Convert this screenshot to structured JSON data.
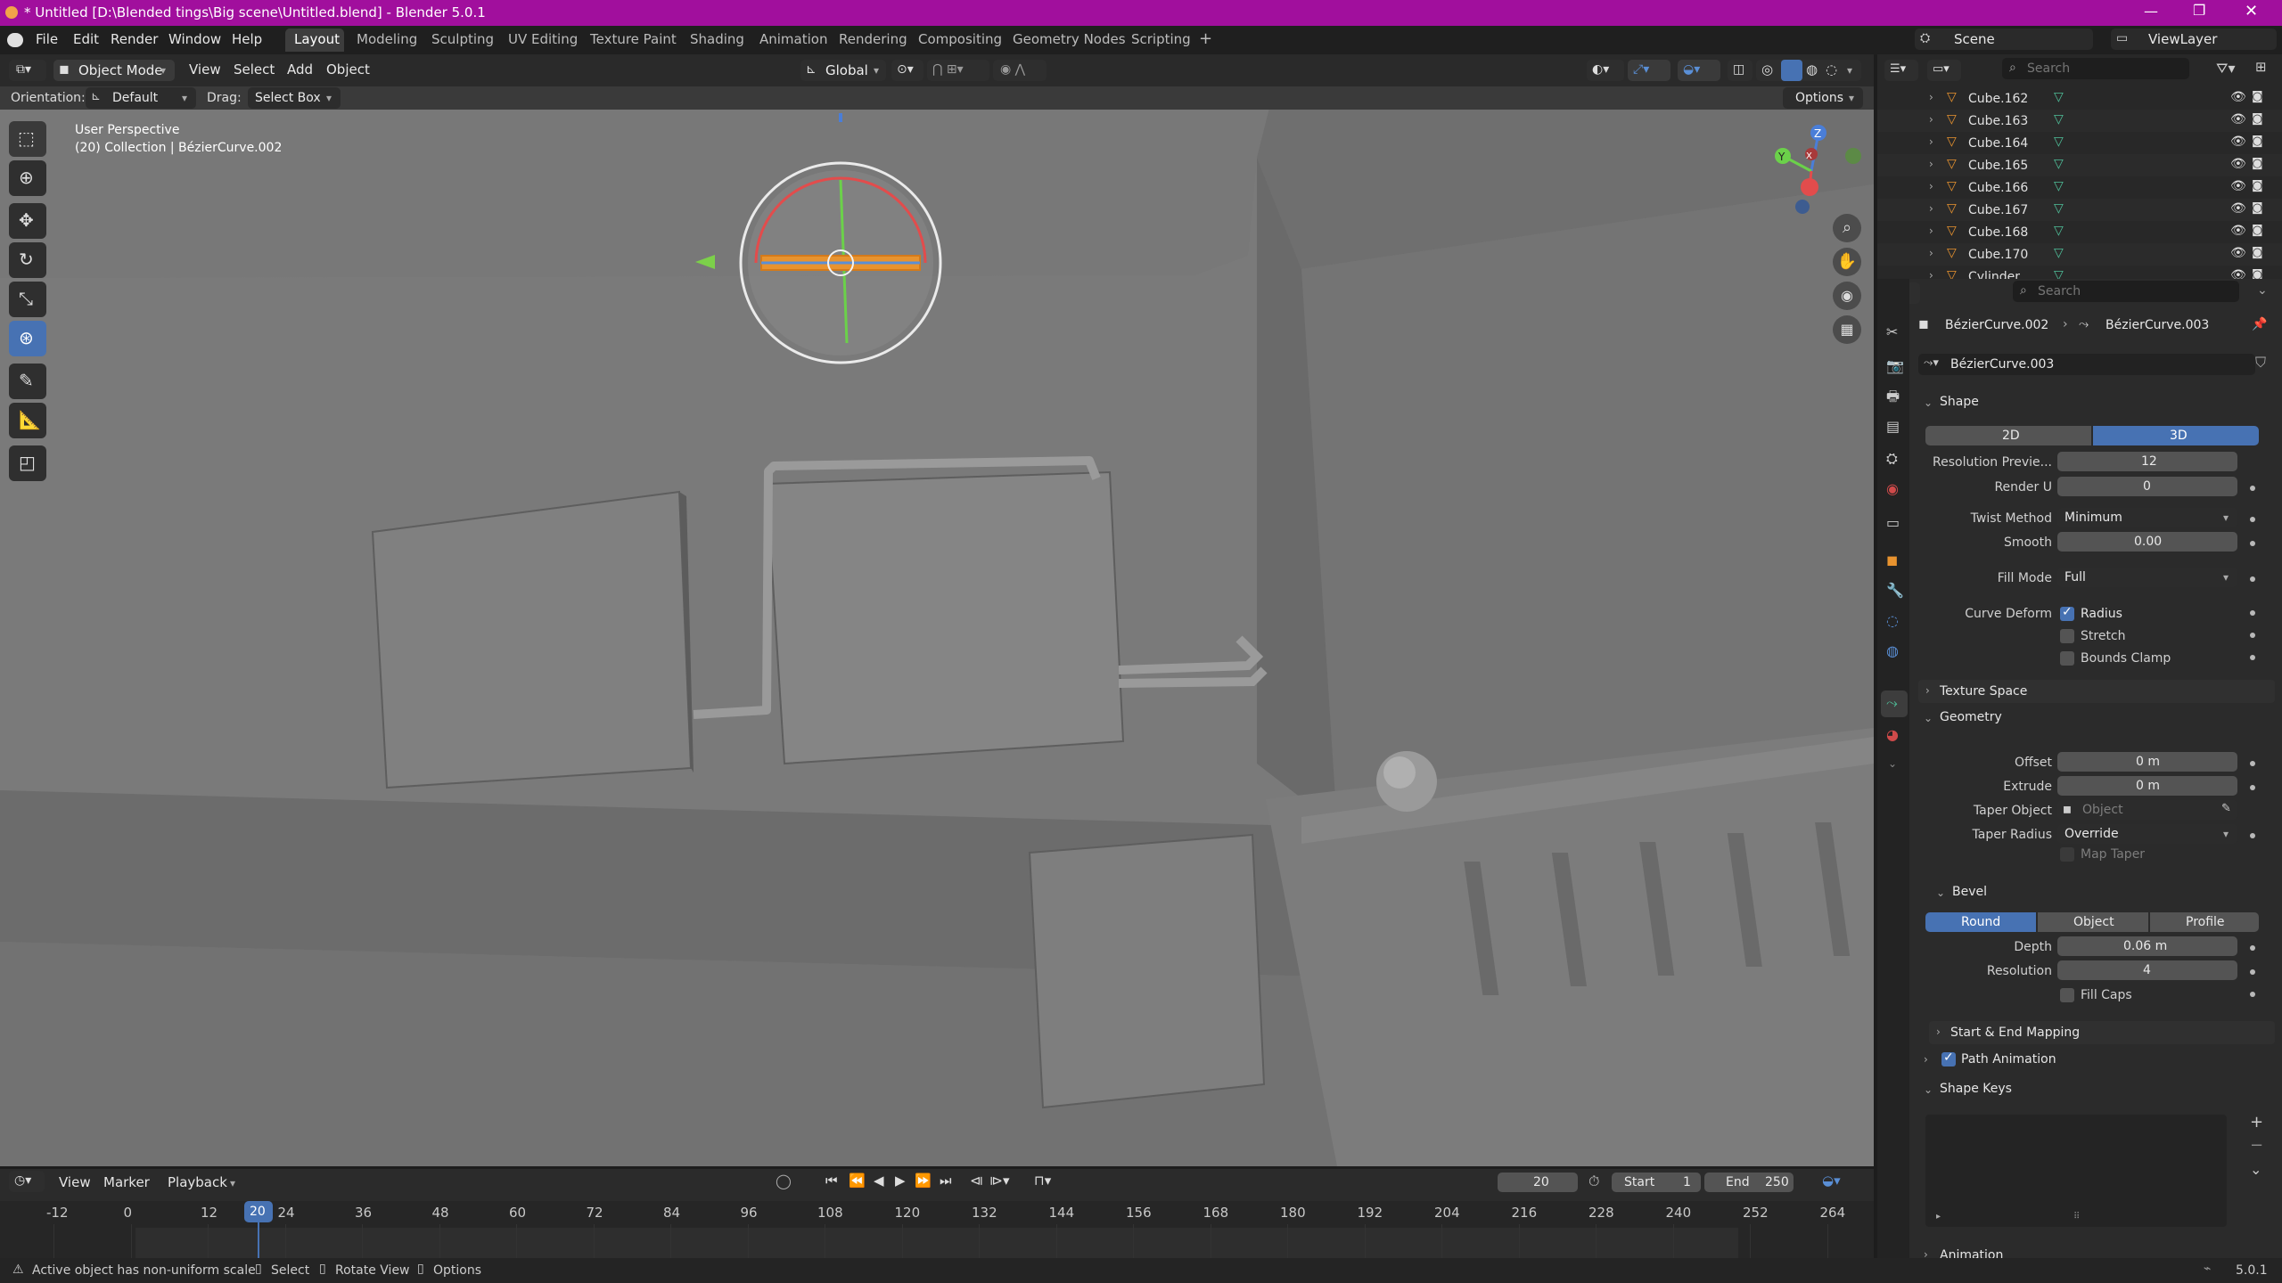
{
  "window": {
    "title": "* Untitled [D:\\Blended tings\\Big scene\\Untitled.blend] - Blender 5.0.1"
  },
  "menubar": {
    "file": "File",
    "edit": "Edit",
    "render": "Render",
    "window": "Window",
    "help": "Help"
  },
  "workspaces": [
    "Layout",
    "Modeling",
    "Sculpting",
    "UV Editing",
    "Texture Paint",
    "Shading",
    "Animation",
    "Rendering",
    "Compositing",
    "Geometry Nodes",
    "Scripting"
  ],
  "workspace_add": "+",
  "scene": {
    "scene_name": "Scene",
    "view_layer": "ViewLayer"
  },
  "viewport_header": {
    "mode": "Object Mode",
    "view": "View",
    "select": "Select",
    "add": "Add",
    "object": "Object",
    "transform_orientation": "Global",
    "options": "Options"
  },
  "tool_settings": {
    "orientation_label": "Orientation:",
    "orientation_value": "Default",
    "drag_label": "Drag:",
    "drag_value": "Select Box"
  },
  "viewport": {
    "perspective": "User Perspective",
    "collection_info": "(20) Collection | BézierCurve.002"
  },
  "navigation_gizmo": {
    "x": "X",
    "y": "Y",
    "z": "Z"
  },
  "outliner": {
    "search_placeholder": "Search",
    "items": [
      "Cube.162",
      "Cube.163",
      "Cube.164",
      "Cube.165",
      "Cube.166",
      "Cube.167",
      "Cube.168",
      "Cube.170",
      "Cylinder"
    ]
  },
  "properties": {
    "search_placeholder": "Search",
    "breadcrumb": {
      "object": "BézierCurve.002",
      "data": "BézierCurve.003"
    },
    "datablock_name": "BézierCurve.003",
    "shape": {
      "header": "Shape",
      "btn_2d": "2D",
      "btn_3d": "3D",
      "resolution_preview_label": "Resolution Previe...",
      "resolution_preview": "12",
      "render_u_label": "Render U",
      "render_u": "0",
      "twist_method_label": "Twist Method",
      "twist_method": "Minimum",
      "smooth_label": "Smooth",
      "smooth": "0.00",
      "fill_mode_label": "Fill Mode",
      "fill_mode": "Full",
      "curve_deform_label": "Curve Deform",
      "radius": "Radius",
      "stretch": "Stretch",
      "bounds_clamp": "Bounds Clamp"
    },
    "texture_space": {
      "header": "Texture Space"
    },
    "geometry": {
      "header": "Geometry",
      "offset_label": "Offset",
      "offset": "0 m",
      "extrude_label": "Extrude",
      "extrude": "0 m",
      "taper_object_label": "Taper Object",
      "taper_object_placeholder": "Object",
      "taper_radius_label": "Taper Radius",
      "taper_radius": "Override",
      "map_taper": "Map Taper"
    },
    "bevel": {
      "header": "Bevel",
      "round": "Round",
      "object": "Object",
      "profile": "Profile",
      "depth_label": "Depth",
      "depth": "0.06 m",
      "resolution_label": "Resolution",
      "resolution": "4",
      "fill_caps": "Fill Caps"
    },
    "start_end_mapping": {
      "header": "Start & End Mapping"
    },
    "path_animation": {
      "header": "Path Animation"
    },
    "shape_keys": {
      "header": "Shape Keys",
      "add": "+",
      "remove": "−"
    },
    "animation": {
      "header": "Animation"
    }
  },
  "timeline": {
    "view": "View",
    "marker": "Marker",
    "playback": "Playback",
    "current_frame": "20",
    "start_label": "Start",
    "start": "1",
    "end_label": "End",
    "end": "250",
    "ticks": [
      "-12",
      "0",
      "12",
      "24",
      "36",
      "48",
      "60",
      "72",
      "84",
      "96",
      "108",
      "120",
      "132",
      "144",
      "156",
      "168",
      "180",
      "192",
      "204",
      "216",
      "228",
      "240",
      "252",
      "264"
    ]
  },
  "statusbar": {
    "warning": "Active object has non-uniform scale",
    "select": "Select",
    "rotate_view": "Rotate View",
    "options": "Options",
    "version": "5.0.1"
  },
  "colors": {
    "title_bar": "#a10f9d",
    "accent_blue": "#4772b3",
    "viewport_bg": "#7a7a7a",
    "panel_bg": "#2b2b2b",
    "curve_orange": "#e8932f"
  }
}
